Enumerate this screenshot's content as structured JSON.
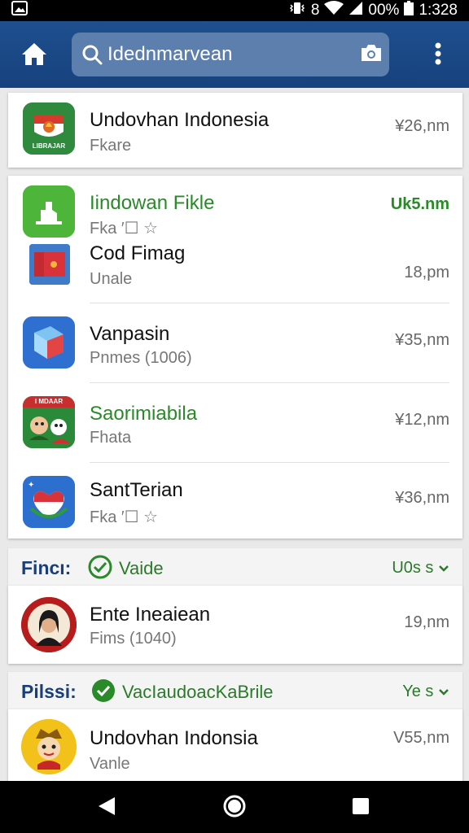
{
  "status_bar": {
    "left_icon": "gallery-notification-icon",
    "battery_text": "00%",
    "time": "1:328",
    "icons": [
      "vibrate-icon",
      "alarm-icon",
      "wifi-icon",
      "signal-icon",
      "battery-icon"
    ]
  },
  "app_bar": {
    "search_value": "Idednmarvean",
    "home_icon": "home-icon",
    "camera_icon": "camera-icon",
    "more_icon": "more-vert-icon",
    "colors": {
      "bar": "#1f4f8f",
      "search_box": "#5c7fae"
    }
  },
  "results": [
    {
      "title": "Undovhan Indonesia",
      "subtitle": "Fkare",
      "meta": "¥26,nm",
      "icon": "indonesia-emblem-icon",
      "icon_caption": "LIBRAJAR",
      "title_color": "default"
    },
    {
      "title": "Iindowan Fikle",
      "subtitle": "Fka ′☐ ☆",
      "meta": "Uk5.nm",
      "icon": "green-app-icon",
      "title_color": "green"
    },
    {
      "title": "Cod Fimag",
      "subtitle": "Unale",
      "meta": "18,pm",
      "icon": "flag-card-icon",
      "title_color": "default"
    },
    {
      "title": "Vanpasin",
      "subtitle": "Pnmes (1006)",
      "meta": "¥35,nm",
      "icon": "play-cube-icon",
      "title_color": "default"
    },
    {
      "title": "Saorimiabila",
      "subtitle": "Fhata",
      "meta": "¥12,nm",
      "icon": "cartoon-characters-icon",
      "icon_caption": "I MDAAR",
      "title_color": "green"
    },
    {
      "title": "SantTerian",
      "subtitle": "Fka ′☐ ☆",
      "meta": "¥36,nm",
      "icon": "indonesia-heart-icon",
      "title_color": "default"
    }
  ],
  "section1": {
    "label": "Fincı:",
    "check_text": "Vaide",
    "filter": "U0s s",
    "row": {
      "title": "Ente Ineaiean",
      "subtitle": "Fims (1040)",
      "meta": "19,nm",
      "icon": "woman-portrait-icon"
    }
  },
  "section2": {
    "label": "Pilssi:",
    "check_text": "VacIaudoacKaBrile",
    "filter": "Ye s",
    "row": {
      "title": "Undovhan Indonsia",
      "subtitle": "Vanle",
      "meta": "V55,nm",
      "icon": "mascot-character-icon"
    }
  },
  "nav_bar": {
    "icons": [
      "back-icon",
      "home-circle-icon",
      "recents-icon"
    ]
  },
  "colors": {
    "accent_green": "#2a8a2a",
    "header_blue": "#1a3f78"
  }
}
